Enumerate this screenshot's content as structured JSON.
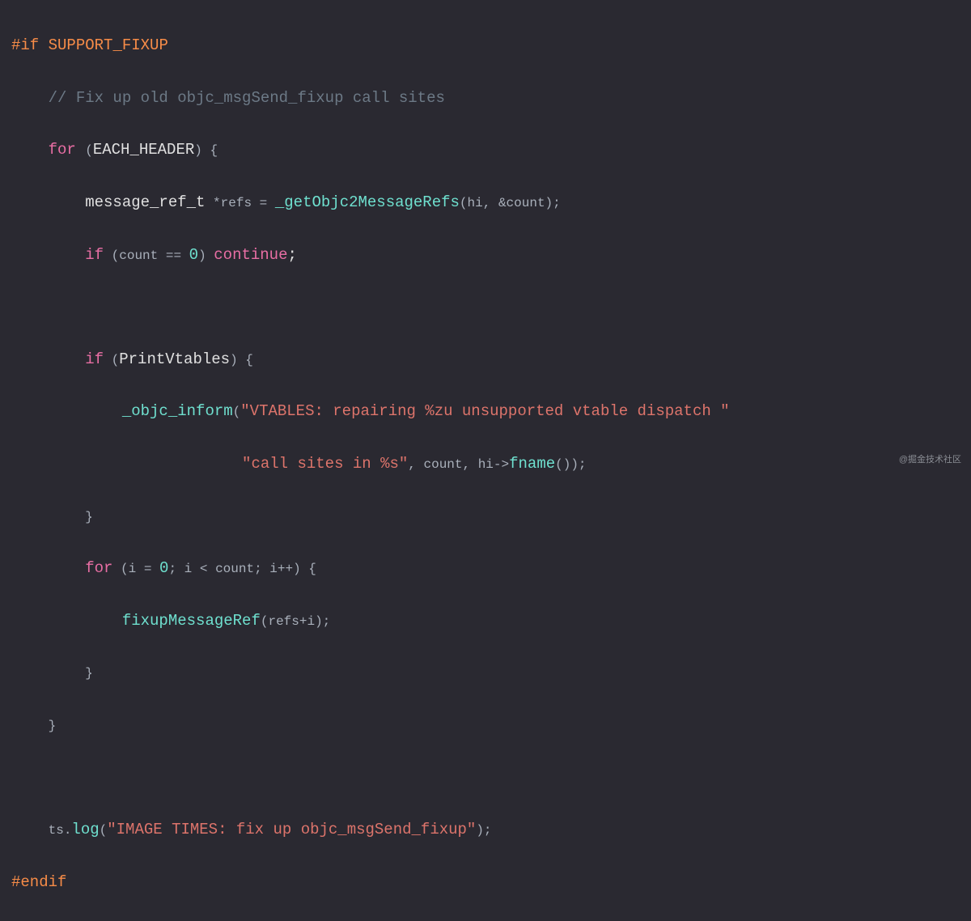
{
  "code": {
    "l1": {
      "dir": "#if",
      "macro": "SUPPORT_FIXUP"
    },
    "l2": {
      "comment": "// Fix up old objc_msgSend_fixup call sites"
    },
    "l3": {
      "kw": "for",
      "paren_l": "(",
      "ident": "EACH_HEADER",
      "paren_r": ")",
      "brace": " {"
    },
    "l4": {
      "type": "message_ref_t",
      "ptr": " *refs = ",
      "func": "_getObjc2MessageRefs",
      "args_l": "(",
      "args": "hi, &count",
      "args_r": ");"
    },
    "l5": {
      "kw1": "if",
      "cond_l": " (",
      "cond_var": "count == ",
      "zero": "0",
      "cond_r": ") ",
      "kw2": "continue",
      "semi": ";"
    },
    "l7": {
      "kw": "if",
      "cond_l": " (",
      "cond": "PrintVtables",
      "cond_r": ") {"
    },
    "l8": {
      "func": "_objc_inform",
      "paren_l": "(",
      "str": "\"VTABLES: repairing %zu unsupported vtable dispatch \""
    },
    "l9": {
      "str": "\"call sites in %s\"",
      "args": ", count, hi->",
      "func": "fname",
      "tail": "());"
    },
    "l10": {
      "brace": "}"
    },
    "l11": {
      "kw": "for",
      "p1": " (i = ",
      "zero": "0",
      "p2": "; i < count; i++) {"
    },
    "l12": {
      "func": "fixupMessageRef",
      "args": "(refs+i);"
    },
    "l13": {
      "brace": "}"
    },
    "l14": {
      "brace": "}"
    },
    "l16": {
      "obj": "ts.",
      "func": "log",
      "paren_l": "(",
      "str": "\"IMAGE TIMES: fix up objc_msgSend_fixup\"",
      "paren_r": ");"
    },
    "l17": {
      "dir": "#endif"
    }
  },
  "watermark": "@掘金技术社区"
}
